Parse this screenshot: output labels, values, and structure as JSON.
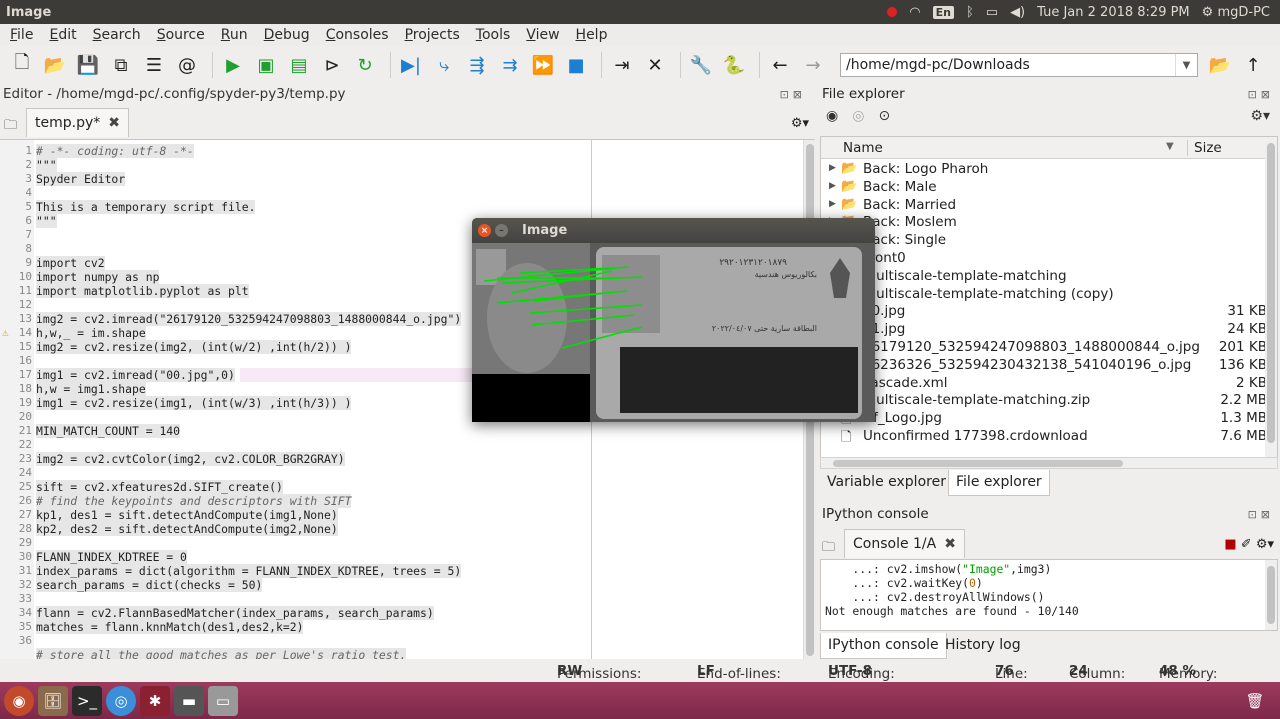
{
  "window_title": "Image",
  "tray": {
    "lang": "En",
    "datetime": "Tue Jan  2 2018  8:29 PM",
    "user": "mgD-PC"
  },
  "menu": [
    "File",
    "Edit",
    "Search",
    "Source",
    "Run",
    "Debug",
    "Consoles",
    "Projects",
    "Tools",
    "View",
    "Help"
  ],
  "path": "/home/mgd-pc/Downloads",
  "editor": {
    "title": "Editor - /home/mgd-pc/.config/spyder-py3/temp.py",
    "tab": "temp.py*",
    "lines": [
      {
        "n": "1",
        "t": "# -*- coding: utf-8 -*-",
        "c": true
      },
      {
        "n": "2",
        "t": "\"\"\""
      },
      {
        "n": "3",
        "t": "Spyder Editor"
      },
      {
        "n": "4",
        "t": ""
      },
      {
        "n": "5",
        "t": "This is a temporary script file."
      },
      {
        "n": "6",
        "t": "\"\"\""
      },
      {
        "n": "7",
        "t": ""
      },
      {
        "n": "8",
        "t": ""
      },
      {
        "n": "9",
        "t": "import cv2"
      },
      {
        "n": "10",
        "t": "import numpy as np"
      },
      {
        "n": "11",
        "t": "import matplotlib.pyplot as plt"
      },
      {
        "n": "12",
        "t": ""
      },
      {
        "n": "13",
        "t": "img2 = cv2.imread(\"26179120_532594247098803_1488000844_o.jpg\")"
      },
      {
        "n": "14",
        "t": "h,w,_ = im.shape",
        "w": true
      },
      {
        "n": "15",
        "t": "img2 = cv2.resize(img2, (int(w/2) ,int(h/2)) )"
      },
      {
        "n": "16",
        "t": ""
      },
      {
        "n": "17",
        "t": "img1 = cv2.imread(\"00.jpg\",0)"
      },
      {
        "n": "18",
        "t": "h,w = img1.shape"
      },
      {
        "n": "19",
        "t": "img1 = cv2.resize(img1, (int(w/3) ,int(h/3)) )"
      },
      {
        "n": "20",
        "t": ""
      },
      {
        "n": "21",
        "t": "MIN_MATCH_COUNT = 140"
      },
      {
        "n": "22",
        "t": ""
      },
      {
        "n": "23",
        "t": "img2 = cv2.cvtColor(img2, cv2.COLOR_BGR2GRAY)"
      },
      {
        "n": "24",
        "t": ""
      },
      {
        "n": "25",
        "t": "sift = cv2.xfeatures2d.SIFT_create()"
      },
      {
        "n": "26",
        "t": "# find the keypoints and descriptors with SIFT",
        "c": true
      },
      {
        "n": "27",
        "t": "kp1, des1 = sift.detectAndCompute(img1,None)"
      },
      {
        "n": "28",
        "t": "kp2, des2 = sift.detectAndCompute(img2,None)"
      },
      {
        "n": "29",
        "t": ""
      },
      {
        "n": "30",
        "t": "FLANN_INDEX_KDTREE = 0"
      },
      {
        "n": "31",
        "t": "index_params = dict(algorithm = FLANN_INDEX_KDTREE, trees = 5)"
      },
      {
        "n": "32",
        "t": "search_params = dict(checks = 50)"
      },
      {
        "n": "33",
        "t": ""
      },
      {
        "n": "34",
        "t": "flann = cv2.FlannBasedMatcher(index_params, search_params)"
      },
      {
        "n": "35",
        "t": "matches = flann.knnMatch(des1,des2,k=2)"
      },
      {
        "n": "36",
        "t": ""
      },
      {
        "n": "",
        "t": "# store all the good matches as per Lowe's ratio test.",
        "c": true
      }
    ]
  },
  "file_explorer": {
    "title": "File explorer",
    "col_name": "Name",
    "col_size": "Size",
    "rows": [
      {
        "name": "Back: Logo Pharoh",
        "size": "",
        "folder": true
      },
      {
        "name": "Back: Male",
        "size": "",
        "folder": true
      },
      {
        "name": "Back: Married",
        "size": "",
        "folder": true
      },
      {
        "name": "Back: Moslem",
        "size": "",
        "folder": true
      },
      {
        "name": "Back: Single",
        "size": "",
        "folder": true
      },
      {
        "name": "Front0",
        "size": "",
        "folder": true
      },
      {
        "name": "multiscale-template-matching",
        "size": "",
        "folder": true
      },
      {
        "name": "multiscale-template-matching (copy)",
        "size": "",
        "folder": true
      },
      {
        "name": "00.jpg",
        "size": "31 KB",
        "folder": false
      },
      {
        "name": "01.jpg",
        "size": "24 KB",
        "folder": false
      },
      {
        "name": "26179120_532594247098803_1488000844_o.jpg",
        "size": "201 KB",
        "folder": false
      },
      {
        "name": "26236326_532594230432138_541040196_o.jpg",
        "size": "136 KB",
        "folder": false
      },
      {
        "name": "cascade.xml",
        "size": "2 KB",
        "folder": false
      },
      {
        "name": "multiscale-template-matching.zip",
        "size": "2.2 MB",
        "folder": false
      },
      {
        "name": "Nf_Logo.jpg",
        "size": "1.3 MB",
        "folder": false
      },
      {
        "name": "Unconfirmed 177398.crdownload",
        "size": "7.6 MB",
        "folder": false
      }
    ],
    "tabs": [
      "Variable explorer",
      "File explorer"
    ]
  },
  "ipython": {
    "title": "IPython console",
    "tab": "Console 1/A",
    "lines": [
      {
        "pre": "    ...: cv2.imshow(",
        "s": "\"Image\"",
        "post": ",img3)"
      },
      {
        "pre": "    ...: cv2.waitKey(",
        "s": "0",
        "post": ")"
      },
      {
        "pre": "    ...: cv2.destroyAllWindows()",
        "s": "",
        "post": ""
      },
      {
        "pre": "Not enough matches are found - 10/140",
        "s": "",
        "post": ""
      }
    ],
    "tabs": [
      "IPython console",
      "History log"
    ]
  },
  "status": {
    "perm_label": "Permissions:",
    "perm": "RW",
    "eol_label": "End-of-lines:",
    "eol": "LF",
    "enc_label": "Encoding:",
    "enc": "UTF-8",
    "line_label": "Line:",
    "line": "76",
    "col_label": "Column:",
    "col": "24",
    "mem_label": "Memory:",
    "mem": "48 %"
  },
  "image_window": {
    "title": "Image",
    "card_text": [
      "٢٩٢٠١٢٣١٢٠١٨٧٩",
      "بكالوريوس هندسية",
      "البطاقة سارية حتى ٢٠٢٢/٠٤/٠٧"
    ]
  }
}
